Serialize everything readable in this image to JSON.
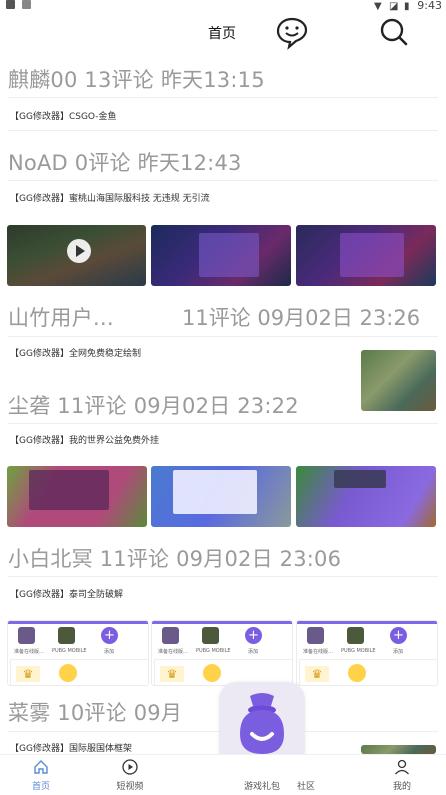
{
  "status_bar": {
    "time": "9:43"
  },
  "header": {
    "title": "首页",
    "chat_icon": "chat-bubble-icon",
    "search_icon": "search-icon"
  },
  "posts": [
    {
      "author": "麒麟00",
      "comments": "13评论",
      "time": "昨天13:15",
      "tag": "【GG修改器】CSGO-金鱼"
    },
    {
      "author": "NoAD",
      "comments": "0评论",
      "time": "昨天12:43",
      "tag": "【GG修改器】蜜桃山海国际服科技 无违规 无引流"
    },
    {
      "author": "山竹用户…",
      "comments": "11评论",
      "time": "09月02日 23:26",
      "tag": "【GG修改器】全网免费稳定绘制"
    },
    {
      "author": "尘砻",
      "comments": "11评论",
      "time": "09月02日 23:22",
      "tag": "【GG修改器】我的世界公益免费外挂"
    },
    {
      "author": "小白北冥",
      "comments": "11评论",
      "time": "09月02日 23:06",
      "tag": "【GG修改器】泰司全防破解"
    },
    {
      "author": "菜雾",
      "comments": "10评论",
      "time": "09月",
      "tag": "【GG修改器】国际服国体框架"
    }
  ],
  "thumb_caption": {
    "left": "准备在线版…",
    "mid": "PUBG MOBILE",
    "right": "添加"
  },
  "bottom_nav": {
    "home": "首页",
    "short_video": "短视频",
    "center": "游戏礼包",
    "community": "社区",
    "mine": "我的"
  },
  "colors": {
    "accent": "#7b5de0",
    "nav_active": "#5b8ad6",
    "meta_text": "#9a9a9a"
  }
}
